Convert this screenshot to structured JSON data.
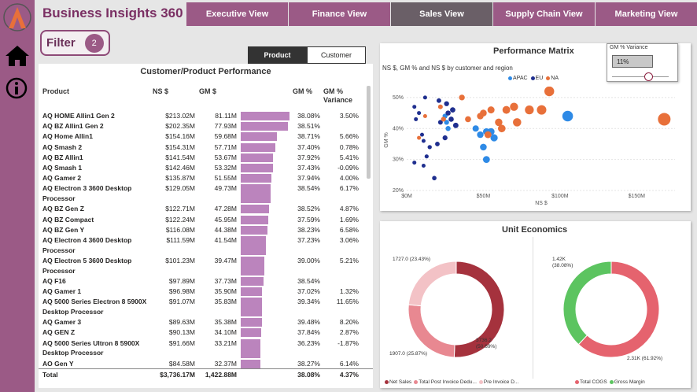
{
  "app": {
    "title": "Business Insights 360"
  },
  "nav": {
    "tabs": [
      {
        "label": "Executive View",
        "active": false
      },
      {
        "label": "Finance View",
        "active": false
      },
      {
        "label": "Sales View",
        "active": true
      },
      {
        "label": "Supply Chain View",
        "active": false
      },
      {
        "label": "Marketing View",
        "active": false
      }
    ]
  },
  "filter": {
    "label": "Filter",
    "count": "2"
  },
  "toggle": {
    "product": "Product",
    "customer": "Customer",
    "active": "Product"
  },
  "table": {
    "title": "Customer/Product Performance",
    "headers": {
      "product": "Product",
      "ns": "NS $",
      "gm": "GM $",
      "gmp": "GM %",
      "var": "GM % Variance"
    },
    "rows": [
      {
        "product": "AQ HOME Allin1 Gen 2",
        "ns": "$213.02M",
        "gm": "81.11M",
        "gm_value": 81.11,
        "gmp": "38.08%",
        "var": "3.50%"
      },
      {
        "product": "AQ BZ Allin1 Gen 2",
        "ns": "$202.35M",
        "gm": "77.93M",
        "gm_value": 77.93,
        "gmp": "38.51%",
        "var": ""
      },
      {
        "product": "AQ Home Allin1",
        "ns": "$154.16M",
        "gm": "59.68M",
        "gm_value": 59.68,
        "gmp": "38.71%",
        "var": "5.66%"
      },
      {
        "product": "AQ Smash 2",
        "ns": "$154.31M",
        "gm": "57.71M",
        "gm_value": 57.71,
        "gmp": "37.40%",
        "var": "0.78%"
      },
      {
        "product": "AQ BZ Allin1",
        "ns": "$141.54M",
        "gm": "53.67M",
        "gm_value": 53.67,
        "gmp": "37.92%",
        "var": "5.41%"
      },
      {
        "product": "AQ Smash 1",
        "ns": "$142.46M",
        "gm": "53.32M",
        "gm_value": 53.32,
        "gmp": "37.43%",
        "var": "-0.09%"
      },
      {
        "product": "AQ Gamer 2",
        "ns": "$135.87M",
        "gm": "51.55M",
        "gm_value": 51.55,
        "gmp": "37.94%",
        "var": "4.00%"
      },
      {
        "product": "AQ Electron 3 3600 Desktop Processor",
        "ns": "$129.05M",
        "gm": "49.73M",
        "gm_value": 49.73,
        "gmp": "38.54%",
        "var": "6.17%"
      },
      {
        "product": "AQ BZ Gen Z",
        "ns": "$122.71M",
        "gm": "47.28M",
        "gm_value": 47.28,
        "gmp": "38.52%",
        "var": "4.87%"
      },
      {
        "product": "AQ BZ Compact",
        "ns": "$122.24M",
        "gm": "45.95M",
        "gm_value": 45.95,
        "gmp": "37.59%",
        "var": "1.69%"
      },
      {
        "product": "AQ BZ Gen Y",
        "ns": "$116.08M",
        "gm": "44.38M",
        "gm_value": 44.38,
        "gmp": "38.23%",
        "var": "6.58%"
      },
      {
        "product": "AQ Electron 4 3600 Desktop Processor",
        "ns": "$111.59M",
        "gm": "41.54M",
        "gm_value": 41.54,
        "gmp": "37.23%",
        "var": "3.06%"
      },
      {
        "product": "AQ Electron 5 3600 Desktop Processor",
        "ns": "$101.23M",
        "gm": "39.47M",
        "gm_value": 39.47,
        "gmp": "39.00%",
        "var": "5.21%"
      },
      {
        "product": "AQ F16",
        "ns": "$97.89M",
        "gm": "37.73M",
        "gm_value": 37.73,
        "gmp": "38.54%",
        "var": ""
      },
      {
        "product": "AQ Gamer 1",
        "ns": "$96.98M",
        "gm": "35.90M",
        "gm_value": 35.9,
        "gmp": "37.02%",
        "var": "1.32%"
      },
      {
        "product": "AQ 5000 Series Electron 8 5900X Desktop Processor",
        "ns": "$91.07M",
        "gm": "35.83M",
        "gm_value": 35.83,
        "gmp": "39.34%",
        "var": "11.65%"
      },
      {
        "product": "AQ Gamer 3",
        "ns": "$89.63M",
        "gm": "35.38M",
        "gm_value": 35.38,
        "gmp": "39.48%",
        "var": "8.20%"
      },
      {
        "product": "AQ GEN Z",
        "ns": "$90.13M",
        "gm": "34.10M",
        "gm_value": 34.1,
        "gmp": "37.84%",
        "var": "2.87%"
      },
      {
        "product": "AQ 5000 Series Ultron 8 5900X Desktop Processor",
        "ns": "$91.66M",
        "gm": "33.21M",
        "gm_value": 33.21,
        "gmp": "36.23%",
        "var": "-1.87%"
      },
      {
        "product": "AO Gen Y",
        "ns": "$84.58M",
        "gm": "32.37M",
        "gm_value": 32.37,
        "gmp": "38.27%",
        "var": "6.14%"
      }
    ],
    "total": {
      "label": "Total",
      "ns": "$3,736.17M",
      "gm": "1,422.88M",
      "gmp": "38.08%",
      "var": "4.37%"
    }
  },
  "slicer": {
    "title": "GM % Variance",
    "value": "11%",
    "level": 0.64
  },
  "chart_data": [
    {
      "type": "scatter",
      "title": "Performance Matrix",
      "subtitle": "NS $, GM % and NS $ by customer and region",
      "xlabel": "NS $",
      "ylabel": "GM %",
      "xlim": [
        0,
        175
      ],
      "ylim": [
        20,
        52
      ],
      "x_ticks": [
        "$0M",
        "$50M",
        "$100M",
        "$150M"
      ],
      "y_ticks": [
        "20%",
        "30%",
        "40%",
        "50%"
      ],
      "legend_position": "top",
      "series": [
        {
          "name": "APAC",
          "color": "#2e8ae6",
          "points": [
            [
              25,
              44
            ],
            [
              26,
              42
            ],
            [
              27,
              40
            ],
            [
              45,
              40
            ],
            [
              48,
              38
            ],
            [
              50,
              34
            ],
            [
              52,
              30
            ],
            [
              52,
              39
            ],
            [
              55,
              39
            ],
            [
              57,
              37
            ],
            [
              105,
              44
            ]
          ]
        },
        {
          "name": "EU",
          "color": "#1f2f8f",
          "points": [
            [
              5,
              47
            ],
            [
              6,
              43
            ],
            [
              8,
              45
            ],
            [
              10,
              38
            ],
            [
              11,
              36
            ],
            [
              11,
              28
            ],
            [
              12,
              50
            ],
            [
              13,
              31
            ],
            [
              15,
              34
            ],
            [
              18,
              24
            ],
            [
              20,
              35
            ],
            [
              21,
              49
            ],
            [
              22,
              42
            ],
            [
              25,
              37
            ],
            [
              26,
              48
            ],
            [
              27,
              45
            ],
            [
              29,
              43
            ],
            [
              30,
              46
            ],
            [
              32,
              41
            ],
            [
              5,
              29
            ]
          ]
        },
        {
          "name": "NA",
          "color": "#e8703a",
          "points": [
            [
              8,
              37
            ],
            [
              12,
              44
            ],
            [
              22,
              47
            ],
            [
              24,
              43
            ],
            [
              36,
              50
            ],
            [
              40,
              43
            ],
            [
              48,
              44
            ],
            [
              50,
              45
            ],
            [
              53,
              38
            ],
            [
              55,
              46
            ],
            [
              60,
              42
            ],
            [
              62,
              40
            ],
            [
              65,
              46
            ],
            [
              70,
              47
            ],
            [
              72,
              42
            ],
            [
              80,
              46
            ],
            [
              88,
              46
            ],
            [
              93,
              52
            ],
            [
              168,
              43
            ]
          ]
        }
      ]
    },
    {
      "type": "pie",
      "title": "Unit Economics",
      "labels": [
        "Net Sales",
        "Total Post Invoice Dedu...",
        "Pre Invoice D..."
      ],
      "values": [
        3736.2,
        1907.0,
        1727.0
      ],
      "data_labels": [
        "3736.2 (50.69%)",
        "1907.0 (25.87%)",
        "1727.0 (23.43%)"
      ],
      "colors": [
        "#a5323d",
        "#e88891",
        "#f3c2c6"
      ]
    },
    {
      "type": "pie",
      "labels": [
        "Total COGS",
        "Gross Margin"
      ],
      "values": [
        2.31,
        1.42
      ],
      "data_labels": [
        "2.31K (61.92%)",
        "1.42K (38.08%)"
      ],
      "colors": [
        "#e5636e",
        "#5cc460"
      ]
    }
  ]
}
